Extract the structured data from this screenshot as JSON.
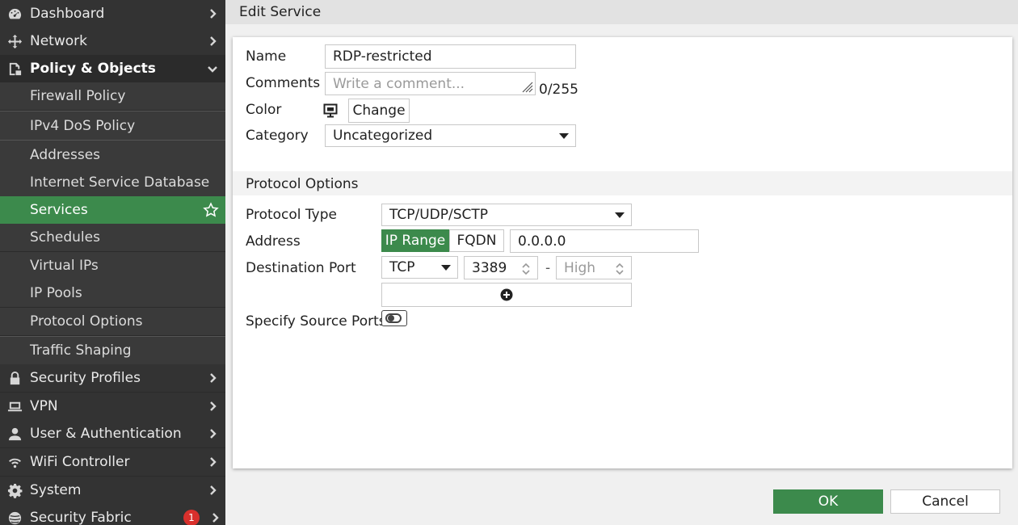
{
  "sidebar": {
    "items": [
      {
        "label": "Dashboard",
        "icon": "dashboard-icon"
      },
      {
        "label": "Network",
        "icon": "network-icon"
      },
      {
        "label": "Policy & Objects",
        "icon": "policy-icon"
      },
      {
        "label": "Security Profiles",
        "icon": "lock-icon"
      },
      {
        "label": "VPN",
        "icon": "laptop-icon"
      },
      {
        "label": "User & Authentication",
        "icon": "user-icon"
      },
      {
        "label": "WiFi Controller",
        "icon": "wifi-icon"
      },
      {
        "label": "System",
        "icon": "gear-icon"
      },
      {
        "label": "Security Fabric",
        "icon": "fabric-icon",
        "badge": "1"
      }
    ],
    "sub_items": [
      "Firewall Policy",
      "IPv4 DoS Policy",
      "Addresses",
      "Internet Service Database",
      "Services",
      "Schedules",
      "Virtual IPs",
      "IP Pools",
      "Protocol Options",
      "Traffic Shaping"
    ],
    "accent_color": "#3c8a4c"
  },
  "header": {
    "title": "Edit Service"
  },
  "form": {
    "name": {
      "label": "Name",
      "value": "RDP-restricted"
    },
    "comments": {
      "label": "Comments",
      "placeholder": "Write a comment...",
      "counter": "0/255"
    },
    "color": {
      "label": "Color",
      "change_label": "Change"
    },
    "category": {
      "label": "Category",
      "value": "Uncategorized"
    },
    "protocol_section": "Protocol Options",
    "protocol_type": {
      "label": "Protocol Type",
      "value": "TCP/UDP/SCTP"
    },
    "address": {
      "label": "Address",
      "ip_range_label": "IP Range",
      "fqdn_label": "FQDN",
      "value": "0.0.0.0"
    },
    "destination_port": {
      "label": "Destination Port",
      "protocol": "TCP",
      "low": "3389",
      "separator": "-",
      "high_placeholder": "High"
    },
    "source_ports": {
      "label": "Specify Source Ports"
    }
  },
  "footer": {
    "ok_label": "OK",
    "cancel_label": "Cancel"
  }
}
